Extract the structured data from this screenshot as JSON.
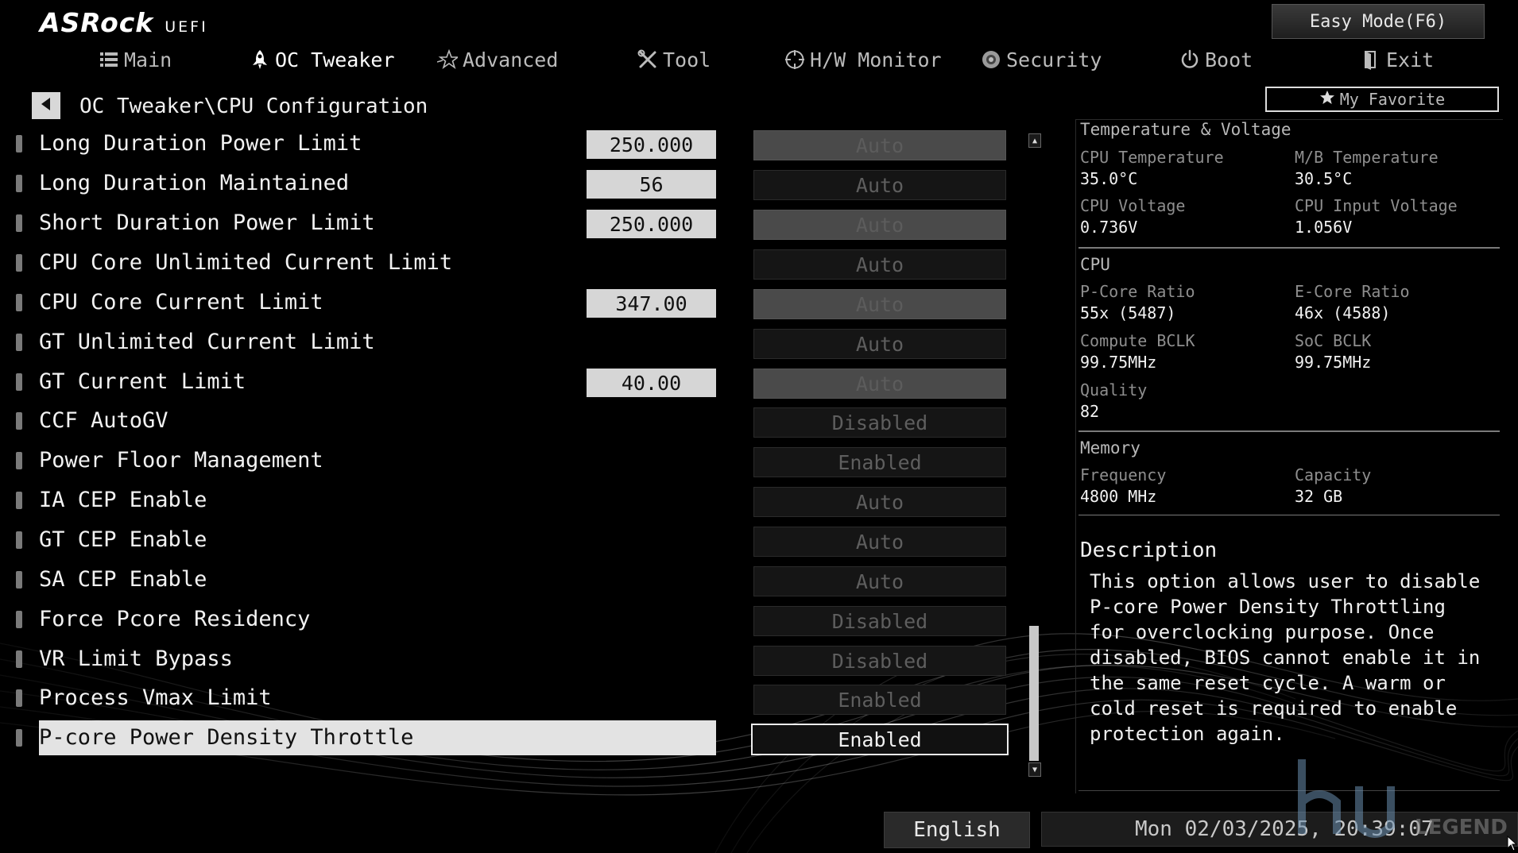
{
  "header": {
    "brand": "ASRock",
    "uefi": "UEFI",
    "easy_mode_label": "Easy Mode(F6)"
  },
  "nav": {
    "tabs": [
      {
        "label": "Main",
        "icon": "list-icon"
      },
      {
        "label": "OC Tweaker",
        "icon": "rocket-icon"
      },
      {
        "label": "Advanced",
        "icon": "star-icon"
      },
      {
        "label": "Tool",
        "icon": "tools-icon"
      },
      {
        "label": "H/W Monitor",
        "icon": "crosshair-icon"
      },
      {
        "label": "Security",
        "icon": "shield-icon"
      },
      {
        "label": "Boot",
        "icon": "power-icon"
      },
      {
        "label": "Exit",
        "icon": "exit-icon"
      }
    ],
    "active_tab": "OC Tweaker"
  },
  "breadcrumb": "OC Tweaker\\CPU Configuration",
  "favorite_label": "My Favorite",
  "settings": [
    {
      "label": "Long Duration Power Limit",
      "value": "250.000",
      "option": "Auto",
      "greyed": true
    },
    {
      "label": "Long Duration Maintained",
      "value": "56",
      "option": "Auto",
      "greyed": false
    },
    {
      "label": "Short Duration Power Limit",
      "value": "250.000",
      "option": "Auto",
      "greyed": true
    },
    {
      "label": "CPU Core Unlimited Current Limit",
      "value": "",
      "option": "Auto",
      "greyed": false
    },
    {
      "label": "CPU Core Current Limit",
      "value": "347.00",
      "option": "Auto",
      "greyed": true
    },
    {
      "label": "GT Unlimited Current Limit",
      "value": "",
      "option": "Auto",
      "greyed": false
    },
    {
      "label": "GT Current Limit",
      "value": "40.00",
      "option": "Auto",
      "greyed": true
    },
    {
      "label": "CCF AutoGV",
      "value": "",
      "option": "Disabled",
      "greyed": false
    },
    {
      "label": "Power Floor Management",
      "value": "",
      "option": "Enabled",
      "greyed": false
    },
    {
      "label": "IA CEP Enable",
      "value": "",
      "option": "Auto",
      "greyed": false
    },
    {
      "label": "GT CEP Enable",
      "value": "",
      "option": "Auto",
      "greyed": false
    },
    {
      "label": "SA CEP Enable",
      "value": "",
      "option": "Auto",
      "greyed": false
    },
    {
      "label": "Force Pcore Residency",
      "value": "",
      "option": "Disabled",
      "greyed": false
    },
    {
      "label": "VR Limit Bypass",
      "value": "",
      "option": "Disabled",
      "greyed": false
    },
    {
      "label": "Process Vmax Limit",
      "value": "",
      "option": "Enabled",
      "greyed": false
    },
    {
      "label": "P-core Power Density Throttle",
      "value": "",
      "option": "Enabled",
      "greyed": false,
      "selected": true
    }
  ],
  "monitor": {
    "temp_voltage_title": "Temperature & Voltage",
    "cpu_temp_label": "CPU Temperature",
    "cpu_temp": "35.0°C",
    "mb_temp_label": "M/B Temperature",
    "mb_temp": "30.5°C",
    "cpu_volt_label": "CPU Voltage",
    "cpu_volt": "0.736V",
    "cpu_input_volt_label": "CPU Input Voltage",
    "cpu_input_volt": "1.056V",
    "cpu_title": "CPU",
    "pcore_label": "P-Core Ratio",
    "pcore": "55x (5487)",
    "ecore_label": "E-Core Ratio",
    "ecore": "46x (4588)",
    "bclk_label": "Compute BCLK",
    "bclk": "99.75MHz",
    "soc_label": "SoC BCLK",
    "soc": "99.75MHz",
    "quality_label": "Quality",
    "quality": "82",
    "memory_title": "Memory",
    "freq_label": "Frequency",
    "freq": "4800 MHz",
    "cap_label": "Capacity",
    "cap": "32 GB"
  },
  "description": {
    "title": "Description",
    "body": "This option allows user to disable P-core Power Density Throttling for overclocking purpose. Once disabled, BIOS cannot enable it in the same reset cycle. A warm or cold reset is required to enable protection again."
  },
  "footer": {
    "language": "English",
    "datetime": "Mon 02/03/2025, 20:39:07"
  },
  "watermark_text": "LEGEND"
}
